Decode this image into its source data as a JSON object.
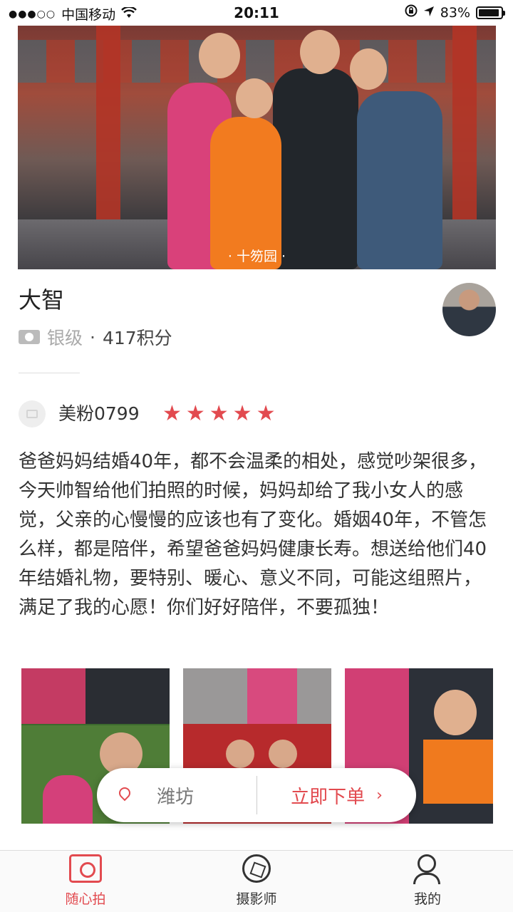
{
  "status_bar": {
    "signal": "●●●○○",
    "carrier": "中国移动",
    "time": "20:11",
    "battery": "83%",
    "battery_level": 0.83
  },
  "hero": {
    "caption": "· 十笏园 ·"
  },
  "profile": {
    "name": "大智",
    "level": "银级",
    "separator": "·",
    "points": "417积分"
  },
  "review": {
    "reviewer": "美粉0799",
    "stars": "★★★★★",
    "rating": 5,
    "text": "爸爸妈妈结婚40年，都不会温柔的相处，感觉吵架很多，今天帅智给他们拍照的时候，妈妈却给了我小女人的感觉，父亲的心慢慢的应该也有了变化。婚姻40年，不管怎么样，都是陪伴，希望爸爸妈妈健康长寿。想送给他们40年结婚礼物，要特别、暖心、意义不同，可能这组照片，满足了我的心愿！你们好好陪伴，不要孤独！"
  },
  "action_pill": {
    "location": "潍坊",
    "order_label": "立即下单",
    "chevron": "›"
  },
  "tabbar": {
    "tabs": [
      {
        "label": "随心拍",
        "icon": "camera-icon",
        "active": true
      },
      {
        "label": "摄影师",
        "icon": "aperture-icon",
        "active": false
      },
      {
        "label": "我的",
        "icon": "person-icon",
        "active": false
      }
    ]
  },
  "colors": {
    "accent": "#e24a4f"
  }
}
